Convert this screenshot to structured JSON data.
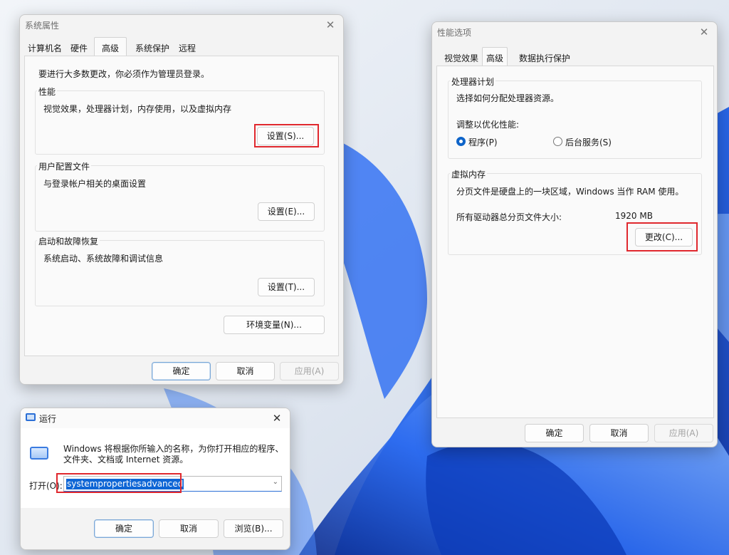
{
  "colors": {
    "accent": "#0f66d5",
    "highlight": "#e0282e",
    "dialog_bg": "#f3f3f3",
    "wallpaper_blue": "#1d5fe0"
  },
  "sysprops": {
    "title": "系统属性",
    "close_icon": "close-icon",
    "tabs": [
      "计算机名",
      "硬件",
      "高级",
      "系统保护",
      "远程"
    ],
    "active_tab": "高级",
    "admin_note": "要进行大多数更改，你必须作为管理员登录。",
    "performance": {
      "title": "性能",
      "desc": "视觉效果，处理器计划，内存使用，以及虚拟内存",
      "button": "设置(S)..."
    },
    "user_profiles": {
      "title": "用户配置文件",
      "desc": "与登录帐户相关的桌面设置",
      "button": "设置(E)..."
    },
    "startup": {
      "title": "启动和故障恢复",
      "desc": "系统启动、系统故障和调试信息",
      "button": "设置(T)..."
    },
    "env_button": "环境变量(N)...",
    "ok": "确定",
    "cancel": "取消",
    "apply": "应用(A)"
  },
  "perfopts": {
    "title": "性能选项",
    "close_icon": "close-icon",
    "tabs": [
      "视觉效果",
      "高级",
      "数据执行保护"
    ],
    "active_tab": "高级",
    "cpu": {
      "title": "处理器计划",
      "desc": "选择如何分配处理器资源。",
      "adjust_label": "调整以优化性能:",
      "option_programs": "程序(P)",
      "option_background": "后台服务(S)",
      "selected": "程序(P)"
    },
    "vmem": {
      "title": "虚拟内存",
      "desc": "分页文件是硬盘上的一块区域，Windows 当作 RAM 使用。",
      "total_label": "所有驱动器总分页文件大小:",
      "total_value": "1920 MB",
      "change_button": "更改(C)..."
    },
    "ok": "确定",
    "cancel": "取消",
    "apply": "应用(A)"
  },
  "run": {
    "title": "运行",
    "app_icon": "run-app-icon",
    "close_icon": "close-icon",
    "description": "Windows 将根据你所输入的名称，为你打开相应的程序、文件夹、文档或 Internet 资源。",
    "desc_line1": "Windows 将根据你所输入的名称，为你打开相应的程序、",
    "desc_line2": "文件夹、文档或 Internet 资源。",
    "open_label": "打开(O):",
    "open_value": "systempropertiesadvanced",
    "ok": "确定",
    "cancel": "取消",
    "browse": "浏览(B)..."
  }
}
